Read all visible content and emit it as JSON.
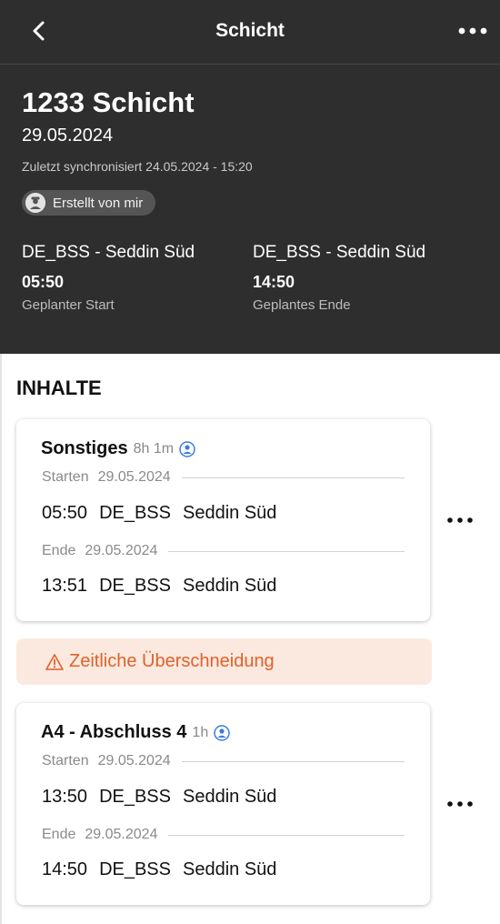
{
  "nav": {
    "title": "Schicht"
  },
  "header": {
    "title": "1233 Schicht",
    "date": "29.05.2024",
    "sync": "Zuletzt synchronisiert 24.05.2024 - 15:20",
    "created_chip": "Erstellt von mir",
    "start": {
      "location": "DE_BSS - Seddin Süd",
      "time": "05:50",
      "caption": "Geplanter Start"
    },
    "end": {
      "location": "DE_BSS - Seddin Süd",
      "time": "14:50",
      "caption": "Geplantes Ende"
    }
  },
  "contents": {
    "title": "INHALTE",
    "warning": "Zeitliche Überschneidung",
    "items": [
      {
        "name": "Sonstiges",
        "duration": "8h 1m",
        "start_label": "Starten",
        "start_date": "29.05.2024",
        "start_time": "05:50",
        "start_code": "DE_BSS",
        "start_station": "Seddin Süd",
        "end_label": "Ende",
        "end_date": "29.05.2024",
        "end_time": "13:51",
        "end_code": "DE_BSS",
        "end_station": "Seddin Süd"
      },
      {
        "name": "A4 - Abschluss 4",
        "duration": "1h",
        "start_label": "Starten",
        "start_date": "29.05.2024",
        "start_time": "13:50",
        "start_code": "DE_BSS",
        "start_station": "Seddin Süd",
        "end_label": "Ende",
        "end_date": "29.05.2024",
        "end_time": "14:50",
        "end_code": "DE_BSS",
        "end_station": "Seddin Süd"
      }
    ]
  },
  "colors": {
    "header_bg": "#2e2e2e",
    "accent_blue": "#3b7be0",
    "warning_bg": "#fbe9df",
    "warning_text": "#e0612a"
  },
  "icons": {
    "back": "chevron-left-icon",
    "more": "more-horizontal-icon",
    "chip": "user-badge-icon",
    "person": "person-circle-icon",
    "warning": "warning-triangle-icon"
  }
}
